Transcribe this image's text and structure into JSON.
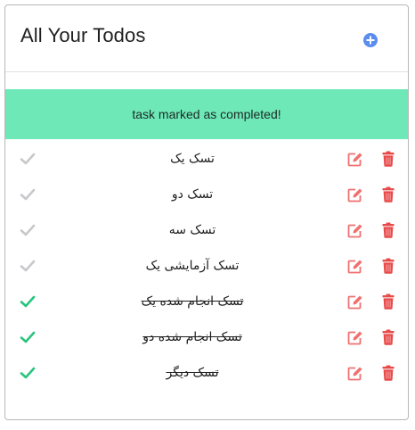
{
  "header": {
    "title": "All Your Todos",
    "add_icon": "plus-circle-icon",
    "accent_color": "#5b8def"
  },
  "alert": {
    "message": "task marked as completed!",
    "background_color": "#6ee8b7"
  },
  "colors": {
    "check_pending": "#c8c8cc",
    "check_done": "#27c47d",
    "edit": "#f07070",
    "delete": "#e84a4a"
  },
  "todos": [
    {
      "text": "تسک یک",
      "completed": false
    },
    {
      "text": "تسک دو",
      "completed": false
    },
    {
      "text": "تسک سه",
      "completed": false
    },
    {
      "text": "تسک آزمایشی یک",
      "completed": false
    },
    {
      "text": "تسک انجام شده یک",
      "completed": true
    },
    {
      "text": "تسک انجام شده دو",
      "completed": true
    },
    {
      "text": "تسک دیگر",
      "completed": true
    }
  ]
}
